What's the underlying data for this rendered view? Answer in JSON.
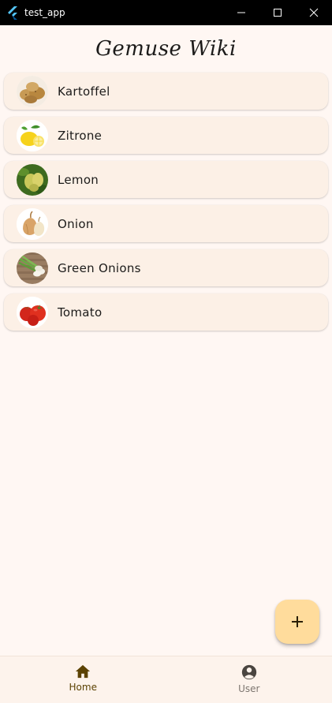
{
  "window": {
    "title": "test_app",
    "controls": [
      "minimize-icon",
      "maximize-icon",
      "close-icon"
    ]
  },
  "app": {
    "title": "Gemuse Wiki"
  },
  "vegetables": [
    {
      "name": "Kartoffel",
      "icon": "potato-image"
    },
    {
      "name": "Zitrone",
      "icon": "lemon-image"
    },
    {
      "name": "Lemon",
      "icon": "lemon-tree-image"
    },
    {
      "name": "Onion",
      "icon": "onion-image"
    },
    {
      "name": "Green Onions",
      "icon": "green-onions-image"
    },
    {
      "name": "Tomato",
      "icon": "tomato-image"
    }
  ],
  "fab": {
    "icon": "add-icon"
  },
  "bottom_nav": {
    "items": [
      {
        "label": "Home",
        "icon": "home-icon",
        "selected": true
      },
      {
        "label": "User",
        "icon": "account-circle-icon",
        "selected": false
      }
    ]
  },
  "colors": {
    "background": "#fff7f3",
    "card": "#fcf0e6",
    "fab": "#ffdc9c",
    "nav_selected": "#5c4203",
    "nav_unselected": "#7d7670"
  }
}
